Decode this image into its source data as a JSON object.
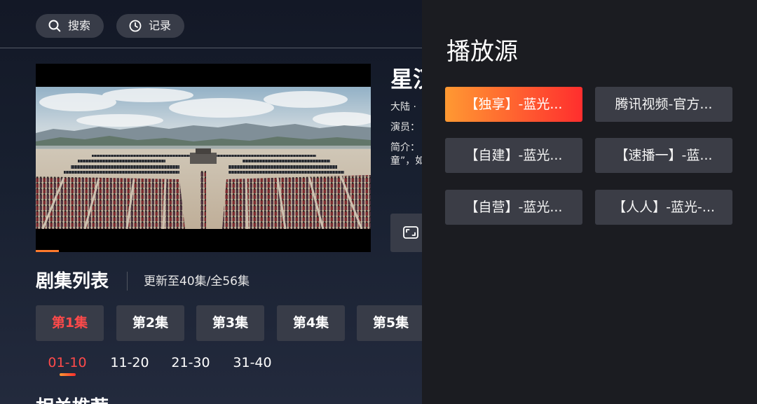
{
  "top_bar": {
    "search_label": "搜索",
    "search_icon": "search-icon",
    "history_label": "记录",
    "history_icon": "clock-icon"
  },
  "player": {
    "progress": 0.07
  },
  "detail": {
    "title": "星汉",
    "meta": "大陆 ·",
    "cast_label": "演员：",
    "intro_label": "简介：",
    "intro_line2": "童”，如",
    "fullscreen_icon": "fullscreen-icon"
  },
  "episodes": {
    "heading": "剧集列表",
    "update_status": "更新至40集/全56集",
    "items": [
      {
        "label": "第1集",
        "selected": true
      },
      {
        "label": "第2集",
        "selected": false
      },
      {
        "label": "第3集",
        "selected": false
      },
      {
        "label": "第4集",
        "selected": false
      },
      {
        "label": "第5集",
        "selected": false
      }
    ],
    "ranges": [
      {
        "label": "01-10",
        "selected": true
      },
      {
        "label": "11-20",
        "selected": false
      },
      {
        "label": "21-30",
        "selected": false
      },
      {
        "label": "31-40",
        "selected": false
      }
    ]
  },
  "recommend": {
    "heading": "相关推荐"
  },
  "source_panel": {
    "title": "播放源",
    "sources": [
      {
        "label": "【独享】-蓝光...",
        "selected": true
      },
      {
        "label": "腾讯视频-官方...",
        "selected": false
      },
      {
        "label": "【自建】-蓝光...",
        "selected": false
      },
      {
        "label": "【速播一】-蓝...",
        "selected": false
      },
      {
        "label": "【自营】-蓝光...",
        "selected": false
      },
      {
        "label": "【人人】-蓝光-...",
        "selected": false
      }
    ]
  },
  "colors": {
    "accent_red": "#ff4a4a",
    "accent_orange": "#ff7a2c",
    "source_start": "#ff9932",
    "source_end": "#ff2e2e",
    "button_bg": "#383c48",
    "panel_bg": "#1b1c21",
    "source_bg": "#3b3d46"
  }
}
